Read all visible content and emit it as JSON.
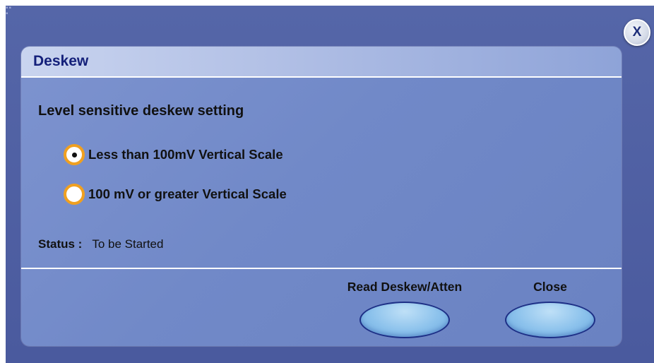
{
  "window": {
    "close_label": "X"
  },
  "dialog": {
    "title": "Deskew",
    "section_heading": "Level sensitive deskew setting",
    "options": [
      {
        "label": "Less than 100mV Vertical Scale",
        "selected": true
      },
      {
        "label": "100 mV or greater Vertical Scale",
        "selected": false
      }
    ],
    "status": {
      "label": "Status :",
      "value": "To be Started"
    },
    "buttons": {
      "read_label": "Read Deskew/Atten",
      "close_label": "Close"
    }
  },
  "colors": {
    "frame": "#4f60a3",
    "panel": "#7189c8",
    "title_text": "#14207a",
    "radio_ring": "#f0a020",
    "button_fill": "#8cc2ec",
    "button_border": "#1d2f86"
  },
  "icons": {
    "window_close": "close-icon",
    "grip": "resize-grip-icon"
  }
}
